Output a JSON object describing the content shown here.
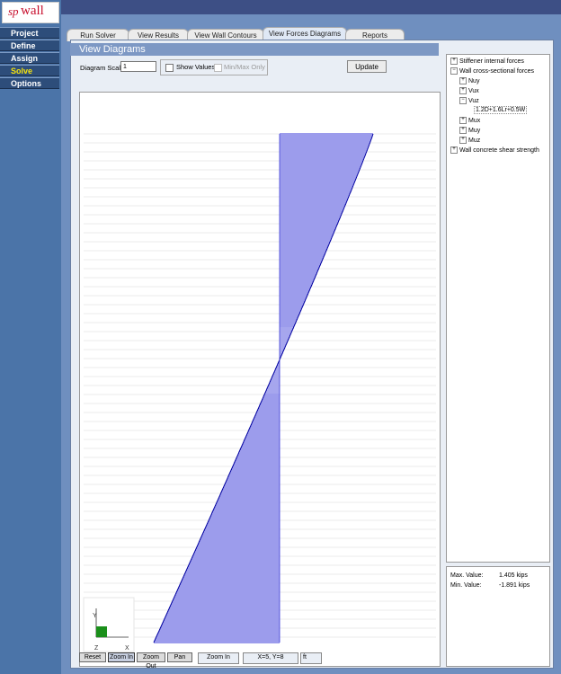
{
  "app": {
    "logo_sp": "sp",
    "logo_wall": "wall"
  },
  "nav": [
    {
      "label": "Project",
      "active": false
    },
    {
      "label": "Define",
      "active": false
    },
    {
      "label": "Assign",
      "active": false
    },
    {
      "label": "Solve",
      "active": true
    },
    {
      "label": "Options",
      "active": false
    }
  ],
  "tabs": [
    {
      "label": "Run Solver",
      "active": false
    },
    {
      "label": "View Results",
      "active": false
    },
    {
      "label": "View Wall Contours",
      "active": false
    },
    {
      "label": "View Forces Diagrams",
      "active": true
    },
    {
      "label": "Reports",
      "active": false
    }
  ],
  "panel": {
    "title": "View Diagrams",
    "diagram_scale_label": "Diagram Scale:",
    "diagram_scale_value": "1",
    "show_values_label": "Show Values",
    "minmax_label": "Min/Max Only",
    "update_label": "Update"
  },
  "tree": {
    "stiffener": "Stiffener internal forces",
    "wall_forces": "Wall cross-sectional forces",
    "nuy": "Nuy",
    "vux": "Vux",
    "vuz": "Vuz",
    "load_combo": "1.2D+1.6Lr+0.5W",
    "mux": "Mux",
    "muy": "Muy",
    "muz": "Muz",
    "shear": "Wall concrete shear strength"
  },
  "values": {
    "max_label": "Max. Value:",
    "max_value": "1.405 kips",
    "min_label": "Min. Value:",
    "min_value": "-1.891 kips"
  },
  "axes": {
    "y": "Y",
    "z": "Z",
    "x": "X"
  },
  "statusbar": {
    "reset": "Reset",
    "zoom_in": "Zoom In",
    "zoom_out": "Zoom Out",
    "pan": "Pan",
    "mode": "Zoom In",
    "coords": "X=5, Y=8",
    "units": "ft"
  },
  "colors": {
    "diagram_fill": "#3a3ad8",
    "diagram_edge": "#0000a0"
  }
}
